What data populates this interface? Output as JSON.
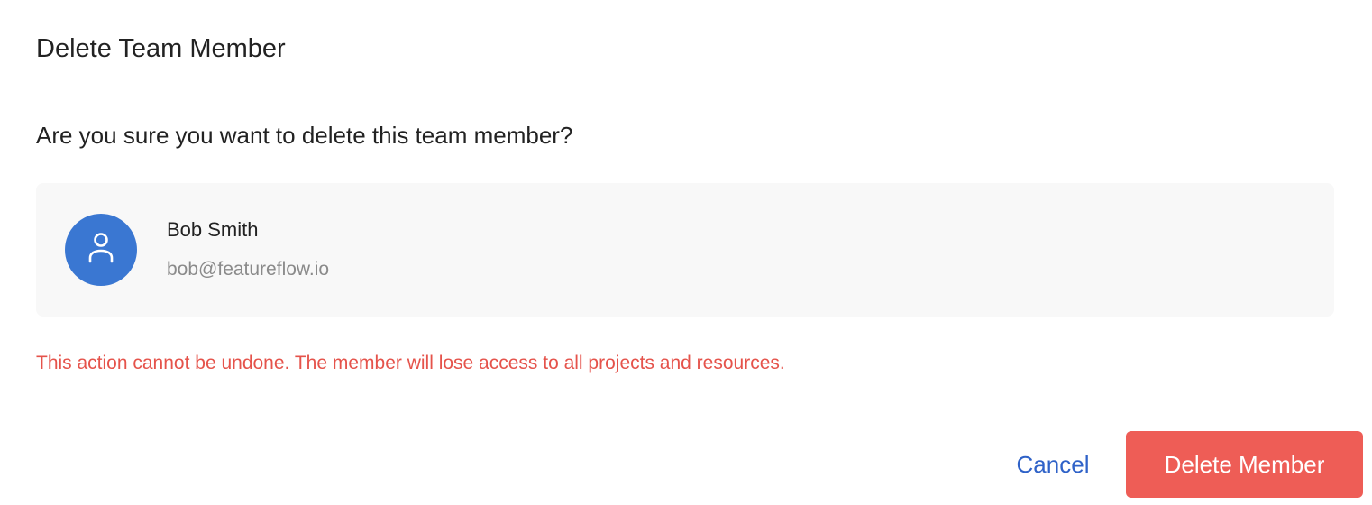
{
  "dialog": {
    "title": "Delete Team Member",
    "question": "Are you sure you want to delete this team member?",
    "warning": "This action cannot be undone. The member will lose access to all projects and resources."
  },
  "member": {
    "name": "Bob Smith",
    "email": "bob@featureflow.io",
    "avatar_icon": "user-icon"
  },
  "actions": {
    "cancel_label": "Cancel",
    "delete_label": "Delete Member"
  },
  "colors": {
    "avatar": "#3a77d2",
    "card_background": "#f8f8f8",
    "warning": "#e5534b",
    "cancel": "#2f62c8",
    "delete_button": "#ee5d56"
  }
}
